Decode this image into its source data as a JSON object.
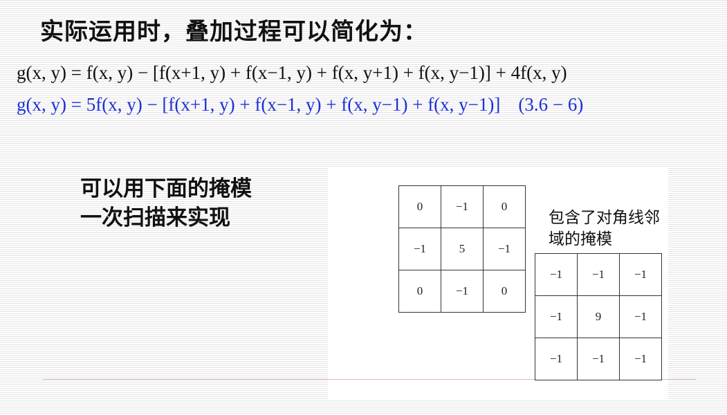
{
  "title": "实际运用时，叠加过程可以简化为：",
  "formula1": {
    "lhs": "g(x, y) = ",
    "body": "f(x, y) − [f(x+1, y) + f(x−1, y) + f(x, y+1) + f(x, y−1)] + 4f(x, y)"
  },
  "formula2": {
    "lhs": "g(x, y) = ",
    "body": "5f(x, y) − [f(x+1, y) + f(x−1, y) + f(x, y−1) + f(x, y−1)]",
    "tag": "(3.6 − 6)"
  },
  "subtext": {
    "line1": "可以用下面的掩模",
    "line2": "一次扫描来实现"
  },
  "diagonal_label": {
    "line1": "包含了对角线邻",
    "line2": "域的掩模"
  },
  "mask4": {
    "rows": [
      [
        "0",
        "−1",
        "0"
      ],
      [
        "−1",
        "5",
        "−1"
      ],
      [
        "0",
        "−1",
        "0"
      ]
    ]
  },
  "mask8": {
    "rows": [
      [
        "−1",
        "−1",
        "−1"
      ],
      [
        "−1",
        "9",
        "−1"
      ],
      [
        "−1",
        "−1",
        "−1"
      ]
    ]
  },
  "colors": {
    "formula2": "#1d2fd8",
    "text": "#111111"
  }
}
